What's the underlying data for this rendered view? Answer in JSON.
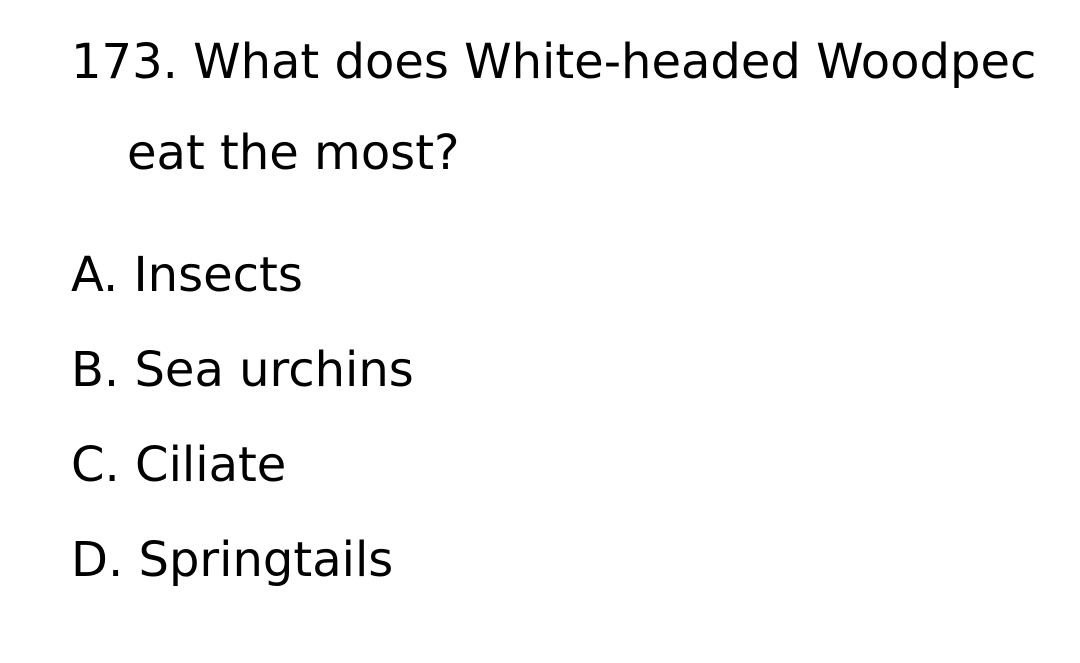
{
  "question": {
    "number_and_text_line1": "173. What does White-headed Woodpec",
    "text_line2": "eat the most?"
  },
  "options": [
    {
      "letter": "A.",
      "text": "Insects"
    },
    {
      "letter": "B.",
      "text": "Sea urchins"
    },
    {
      "letter": "C.",
      "text": "Ciliate"
    },
    {
      "letter": "D.",
      "text": "Springtails"
    }
  ]
}
